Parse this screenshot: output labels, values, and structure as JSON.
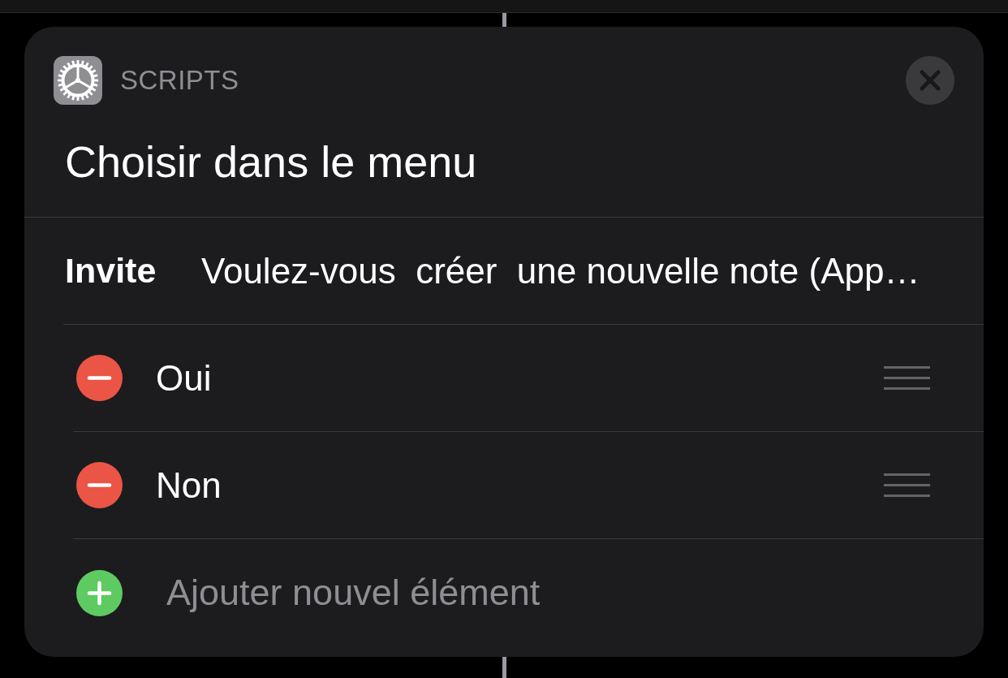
{
  "action_card": {
    "app": {
      "label": "SCRIPTS"
    },
    "title": "Choisir dans le menu",
    "prompt": {
      "label": "Invite",
      "value": "Voulez-vous  créer  une nouvelle note (App…"
    },
    "items": [
      {
        "kind": "option",
        "label": "Oui"
      },
      {
        "kind": "option",
        "label": "Non"
      },
      {
        "kind": "add",
        "label": "Ajouter nouvel élément"
      }
    ]
  }
}
